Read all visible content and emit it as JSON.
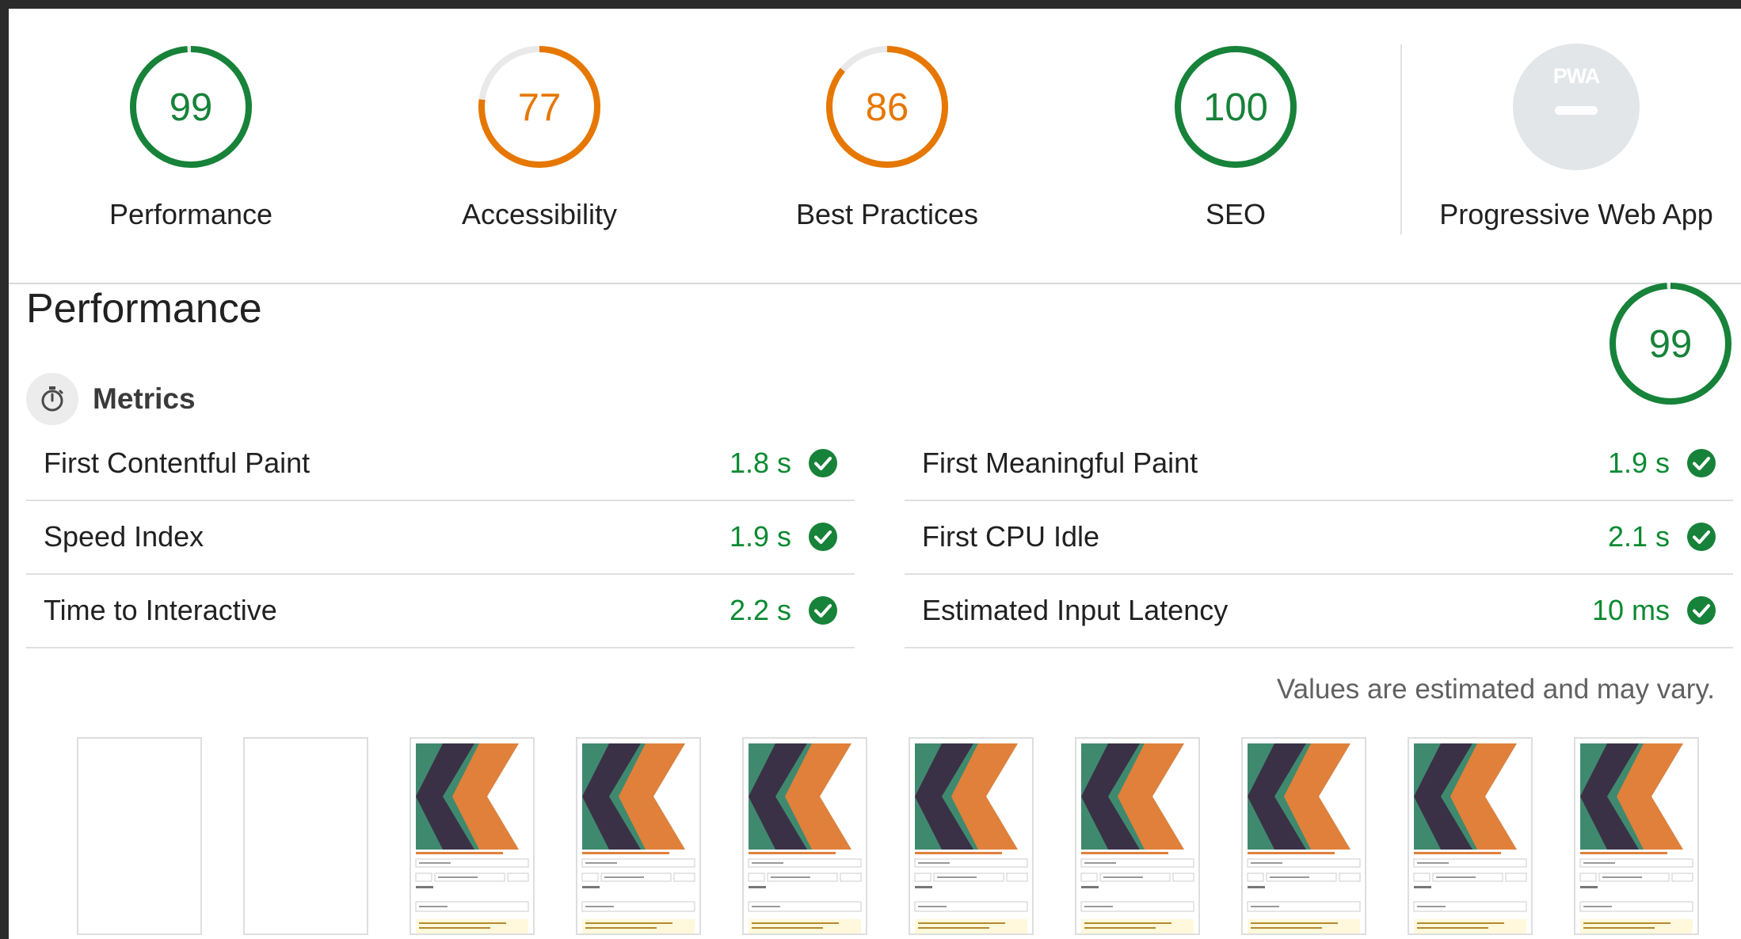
{
  "summary": {
    "gauges": [
      {
        "label": "Performance",
        "score": "99",
        "value": 99,
        "color": "#178239"
      },
      {
        "label": "Accessibility",
        "score": "77",
        "value": 77,
        "color": "#e67700"
      },
      {
        "label": "Best Practices",
        "score": "86",
        "value": 86,
        "color": "#e67700"
      },
      {
        "label": "SEO",
        "score": "100",
        "value": 100,
        "color": "#178239"
      }
    ],
    "pwa": {
      "label": "Progressive Web App",
      "badge_text": "PWA",
      "icon": "pwa-badge-icon"
    }
  },
  "performance": {
    "title": "Performance",
    "score": "99",
    "value": 99,
    "color": "#178239",
    "metrics_title": "Metrics",
    "metrics_icon": "stopwatch-icon",
    "metrics": [
      {
        "label": "First Contentful Paint",
        "value": "1.8 s"
      },
      {
        "label": "First Meaningful Paint",
        "value": "1.9 s"
      },
      {
        "label": "Speed Index",
        "value": "1.9 s"
      },
      {
        "label": "First CPU Idle",
        "value": "2.1 s"
      },
      {
        "label": "Time to Interactive",
        "value": "2.2 s"
      },
      {
        "label": "Estimated Input Latency",
        "value": "10 ms"
      }
    ],
    "pass_color": "#0b8a32",
    "disclaimer": "Values are estimated and may vary."
  },
  "filmstrip": {
    "frames": [
      {
        "state": "blank"
      },
      {
        "state": "blank"
      },
      {
        "state": "loaded"
      },
      {
        "state": "loaded"
      },
      {
        "state": "loaded"
      },
      {
        "state": "loaded"
      },
      {
        "state": "loaded"
      },
      {
        "state": "loaded"
      },
      {
        "state": "loaded"
      },
      {
        "state": "loaded"
      }
    ],
    "logo_colors": {
      "teal": "#3f8a6f",
      "dark": "#3b3146",
      "orange": "#e0803b"
    }
  }
}
